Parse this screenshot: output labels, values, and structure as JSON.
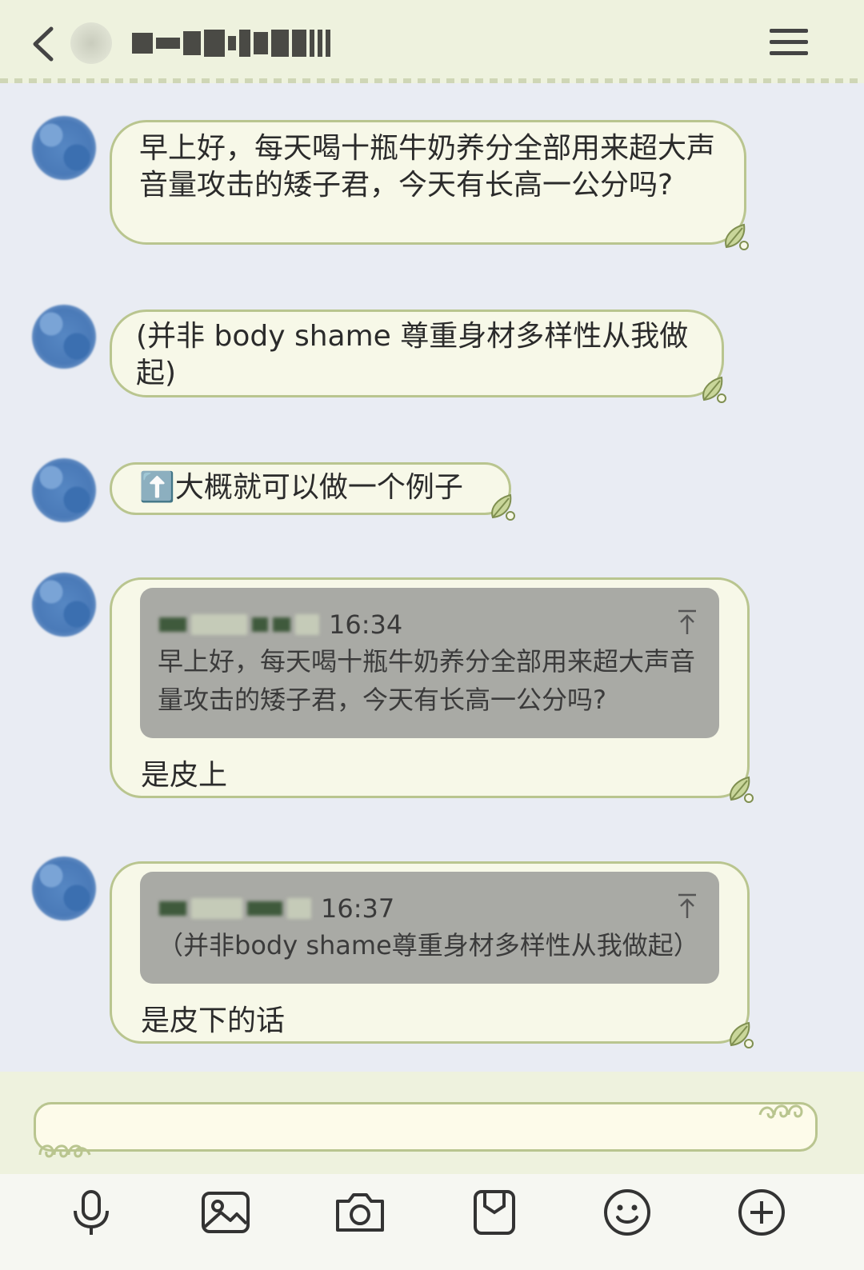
{
  "header": {
    "contact_name": "(blurred)"
  },
  "messages": [
    {
      "text": "早上好，每天喝十瓶牛奶养分全部用来超大声音量攻击的矮子君，今天有长高一公分吗?"
    },
    {
      "text": "(并非 body shame 尊重身材多样性从我做起)"
    },
    {
      "text": "⬆️大概就可以做一个例子"
    },
    {
      "quote_time": "16:34",
      "quote_text": "早上好，每天喝十瓶牛奶养分全部用来超大声音量攻击的矮子君，今天有长高一公分吗?",
      "text": "是皮上"
    },
    {
      "quote_time": "16:37",
      "quote_text": "（并非body shame尊重身材多样性从我做起）",
      "text": "是皮下的话"
    }
  ],
  "input": {
    "placeholder": ""
  },
  "toolbar": [
    "mic-icon",
    "image-icon",
    "camera-icon",
    "sticker-icon",
    "emoji-icon",
    "plus-icon"
  ]
}
